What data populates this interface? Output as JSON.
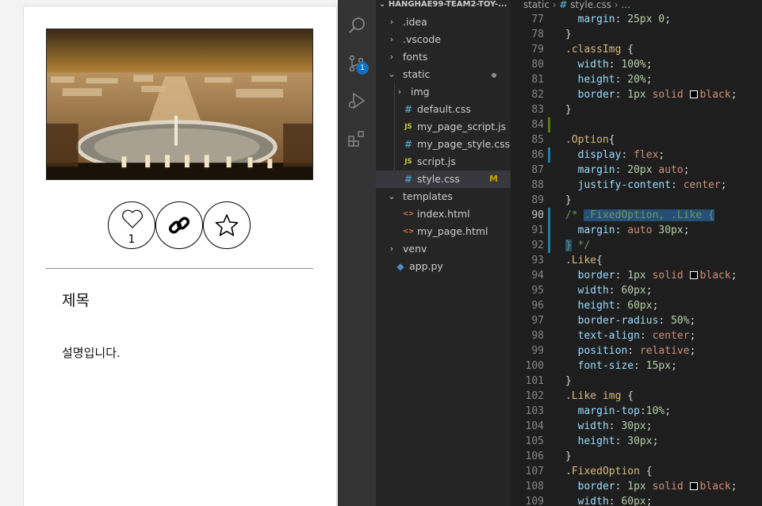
{
  "preview": {
    "like_count": "1",
    "post_title": "제목",
    "post_description": "설명입니다."
  },
  "activity_bar": {
    "icons": [
      "search-icon",
      "source-control-icon",
      "run-debug-icon",
      "extensions-icon"
    ],
    "source_control_badge": "1"
  },
  "explorer": {
    "project_name": "HANGHAE99-TEAM2-TOY-...",
    "items": [
      {
        "label": ".idea",
        "type": "folder",
        "expanded": false
      },
      {
        "label": ".vscode",
        "type": "folder",
        "expanded": false
      },
      {
        "label": "fonts",
        "type": "folder",
        "expanded": false
      },
      {
        "label": "static",
        "type": "folder",
        "expanded": true
      },
      {
        "label": "img",
        "type": "folder",
        "expanded": false
      },
      {
        "label": "default.css",
        "type": "css"
      },
      {
        "label": "my_page_script.js",
        "type": "js"
      },
      {
        "label": "my_page_style.css",
        "type": "css"
      },
      {
        "label": "script.js",
        "type": "js"
      },
      {
        "label": "style.css",
        "type": "css",
        "git_status": "M"
      },
      {
        "label": "templates",
        "type": "folder",
        "expanded": true
      },
      {
        "label": "index.html",
        "type": "html"
      },
      {
        "label": "my_page.html",
        "type": "html"
      },
      {
        "label": "venv",
        "type": "folder",
        "expanded": false
      },
      {
        "label": "app.py",
        "type": "python"
      }
    ]
  },
  "editor": {
    "breadcrumb": [
      "static",
      "style.css",
      "..."
    ],
    "lines": [
      {
        "n": "77",
        "text": "  margin: 25px 0;"
      },
      {
        "n": "78",
        "text": "}"
      },
      {
        "n": "79",
        "text": ".classImg {"
      },
      {
        "n": "80",
        "text": "  width: 100%;"
      },
      {
        "n": "81",
        "text": "  height: 20%;"
      },
      {
        "n": "82",
        "text": "  border: 1px solid black;"
      },
      {
        "n": "83",
        "text": "}"
      },
      {
        "n": "84",
        "text": ""
      },
      {
        "n": "85",
        "text": ".Option{"
      },
      {
        "n": "86",
        "text": "  display: flex;"
      },
      {
        "n": "87",
        "text": "  margin: 20px auto;"
      },
      {
        "n": "88",
        "text": "  justify-content: center;"
      },
      {
        "n": "89",
        "text": "}"
      },
      {
        "n": "90",
        "text": "/* .FixedOption, .Like {"
      },
      {
        "n": "91",
        "text": "  margin: auto 30px;"
      },
      {
        "n": "92",
        "text": "} */"
      },
      {
        "n": "93",
        "text": ".Like{"
      },
      {
        "n": "94",
        "text": "  border: 1px solid black;"
      },
      {
        "n": "95",
        "text": "  width: 60px;"
      },
      {
        "n": "96",
        "text": "  height: 60px;"
      },
      {
        "n": "97",
        "text": "  border-radius: 50%;"
      },
      {
        "n": "98",
        "text": "  text-align: center;"
      },
      {
        "n": "99",
        "text": "  position: relative;"
      },
      {
        "n": "100",
        "text": "  font-size: 15px;"
      },
      {
        "n": "101",
        "text": "}"
      },
      {
        "n": "102",
        "text": ".Like img {"
      },
      {
        "n": "103",
        "text": "  margin-top:10%;"
      },
      {
        "n": "104",
        "text": "  width: 30px;"
      },
      {
        "n": "105",
        "text": "  height: 30px;"
      },
      {
        "n": "106",
        "text": "}"
      },
      {
        "n": "107",
        "text": ".FixedOption {"
      },
      {
        "n": "108",
        "text": "  border: 1px solid black;"
      },
      {
        "n": "109",
        "text": "  width: 60px;"
      }
    ]
  },
  "colors": {
    "editor_bg": "#1e1e1e",
    "sidebar_bg": "#252526",
    "activity_bar_bg": "#333333",
    "selector": "#d7ba7d",
    "property": "#9cdcfe",
    "value": "#ce9178",
    "number": "#b5cea8",
    "comment": "#6a9955",
    "selection": "#264f78",
    "git_modified": "#c4a000",
    "badge": "#0e70c0"
  }
}
